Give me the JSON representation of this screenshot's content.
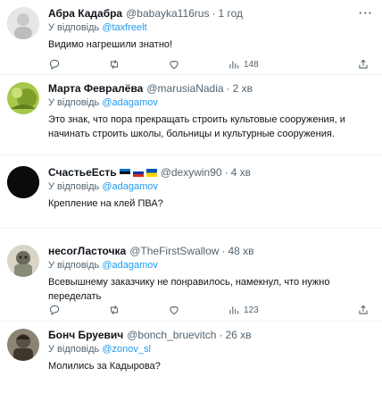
{
  "tweets": [
    {
      "name": "Абра Кадабра",
      "handle": "@babayka116rus",
      "time": "1 год",
      "reply_prefix": "У відповідь",
      "reply_to": "@taxfreelt",
      "text": "Видимо нагрешили знатно!",
      "views": "148"
    },
    {
      "name": "Марта Февралёва",
      "handle": "@marusiaNadia",
      "time": "2 хв",
      "reply_prefix": "У відповідь",
      "reply_to": "@adagamov",
      "text": "Это знак, что пора прекращать строить культовые сооружения, и начинать строить школы, больницы и культурные сооружения."
    },
    {
      "name": "СчастьеЕсть",
      "handle": "@dexywin90",
      "time": "4 хв",
      "reply_prefix": "У відповідь",
      "reply_to": "@adagamov",
      "text": "Крепление на клей ПВА?"
    },
    {
      "name": "несогЛасточка",
      "handle": "@TheFirstSwallow",
      "time": "48 хв",
      "reply_prefix": "У відповідь",
      "reply_to": "@adagamov",
      "text": "Всевышнему заказчику не понравилось, намекнул, что нужно переделать",
      "views": "123"
    },
    {
      "name": "Бонч Бруевич",
      "handle": "@bonch_bruevitch",
      "time": "26 хв",
      "reply_prefix": "У відповідь",
      "reply_to": "@zonov_sl",
      "text": "Молились за Кадырова?"
    }
  ],
  "separator": "·",
  "more_label": "···",
  "icons": [
    "reply-icon",
    "retweet-icon",
    "like-icon",
    "views-icon",
    "share-icon"
  ],
  "colors": {
    "text": "#0f1419",
    "muted": "#536471",
    "link": "#1d9bf0",
    "border": "#eff3f4"
  }
}
